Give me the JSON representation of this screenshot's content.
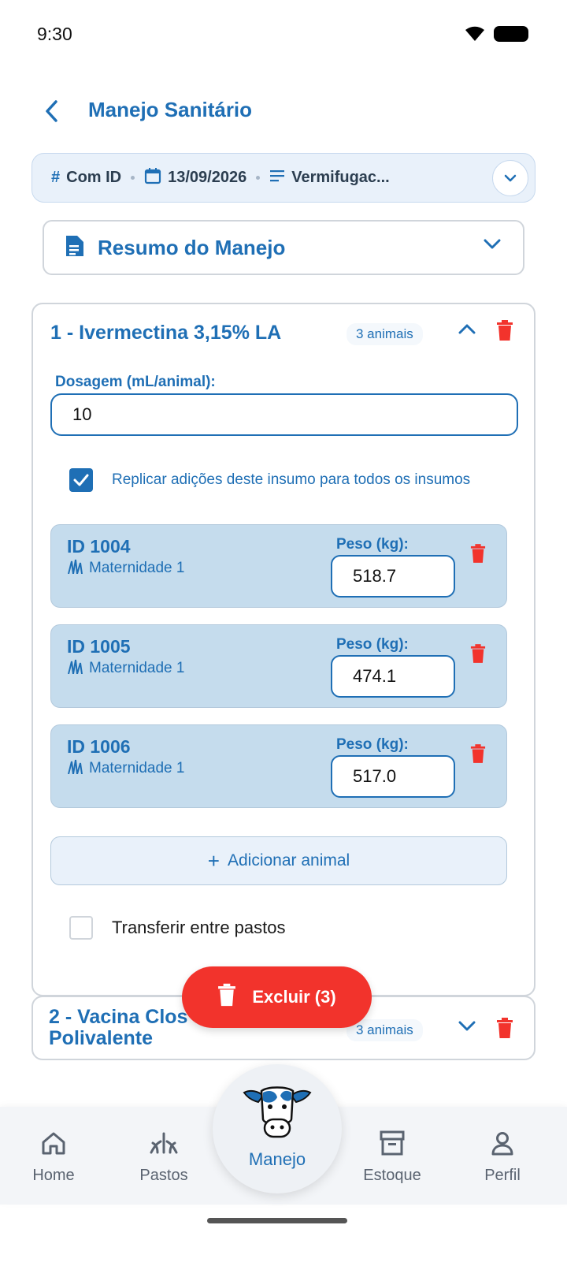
{
  "status_bar": {
    "time": "9:30"
  },
  "header": {
    "title": "Manejo Sanitário"
  },
  "filters": {
    "id_mode": "Com ID",
    "date": "13/09/2026",
    "type": "Vermifugac..."
  },
  "summary": {
    "title": "Resumo do Manejo"
  },
  "products": [
    {
      "title": "1 - Ivermectina 3,15% LA",
      "count": "3 animais",
      "dosage_label": "Dosagem (mL/animal):",
      "dosage_value": "10",
      "replicate_label": "Replicar adições deste insumo para todos os insumos",
      "replicate_checked": true,
      "animals": [
        {
          "id": "ID 1004",
          "location": "Maternidade 1",
          "peso_label": "Peso (kg):",
          "peso": "518.7"
        },
        {
          "id": "ID 1005",
          "location": "Maternidade 1",
          "peso_label": "Peso (kg):",
          "peso": "474.1"
        },
        {
          "id": "ID 1006",
          "location": "Maternidade 1",
          "peso_label": "Peso (kg):",
          "peso": "517.0"
        }
      ],
      "add_animal_label": "Adicionar animal",
      "transfer_label": "Transferir entre pastos",
      "transfer_checked": false
    },
    {
      "title": "2 - Vacina Clos\nPolivalente",
      "count": "3 animais"
    }
  ],
  "delete_button": {
    "label": "Excluir (3)"
  },
  "bottom_nav": {
    "home": "Home",
    "pastos": "Pastos",
    "manejo": "Manejo",
    "estoque": "Estoque",
    "perfil": "Perfil"
  },
  "colors": {
    "primary": "#1f6fb5",
    "danger": "#f2332c",
    "animal_bg": "#c5dced"
  }
}
